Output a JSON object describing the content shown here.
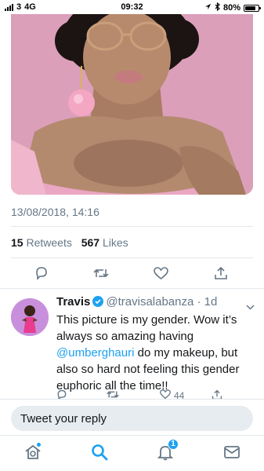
{
  "status_bar": {
    "carrier": "3",
    "network": "4G",
    "time": "09:32",
    "battery": "80%"
  },
  "tweet": {
    "timestamp": "13/08/2018, 14:16",
    "retweets_count": "15",
    "retweets_label": "Retweets",
    "likes_count": "567",
    "likes_label": "Likes"
  },
  "reply": {
    "name": "Travis",
    "handle": "@travisalabanza",
    "separator": "·",
    "age": "1d",
    "text_before": "This picture is my gender. Wow it’s always so amazing having ",
    "mention": "@umberghauri",
    "text_after": " do my makeup, but also so hard not feeling this gender euphoric all the time!!",
    "likes": "44"
  },
  "compose": {
    "placeholder": "Tweet your reply"
  },
  "tabbar": {
    "notifications_badge": "1"
  },
  "colors": {
    "accent": "#1da1f2",
    "muted": "#657786",
    "photo_bg": "#d99ab5"
  },
  "icons": [
    "reply-icon",
    "retweet-icon",
    "like-icon",
    "share-icon",
    "home-icon",
    "search-icon",
    "notifications-icon",
    "messages-icon",
    "verified-icon",
    "chevron-down-icon"
  ]
}
